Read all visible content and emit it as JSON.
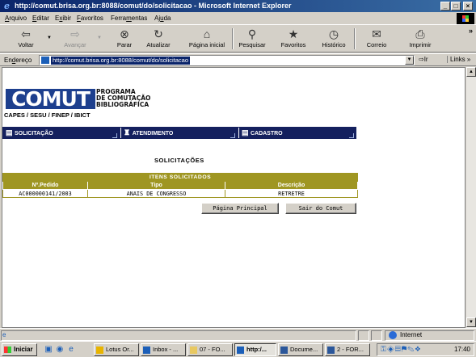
{
  "window": {
    "title": "http://comut.brisa.org.br:8088/comut/do/solicitacao - Microsoft Internet Explorer",
    "controls": {
      "minimize": "_",
      "maximize": "□",
      "close": "×"
    }
  },
  "menu": [
    {
      "label": "Arquivo",
      "key": "A",
      "rest": "rquivo"
    },
    {
      "label": "Editar",
      "key": "E",
      "rest": "ditar"
    },
    {
      "label": "Exibir",
      "pre": "E",
      "key": "x",
      "rest": "ibir"
    },
    {
      "label": "Favoritos",
      "key": "F",
      "rest": "avoritos"
    },
    {
      "label": "Ferramentas",
      "pre": "Ferra",
      "key": "m",
      "rest": "entas"
    },
    {
      "label": "Ajuda",
      "pre": "Aj",
      "key": "u",
      "rest": "da"
    }
  ],
  "toolbar": {
    "back": "Voltar",
    "forward": "Avançar",
    "stop": "Parar",
    "refresh": "Atualizar",
    "home": "Página inicial",
    "search": "Pesquisar",
    "favorites": "Favoritos",
    "history": "Histórico",
    "mail": "Correio",
    "print": "Imprimir",
    "more": "»"
  },
  "icons": {
    "back": "back-arrow-icon",
    "forward": "forward-arrow-icon",
    "stop": "stop-icon",
    "refresh": "refresh-icon",
    "home": "home-icon",
    "search": "search-icon",
    "favorites": "favorites-icon",
    "history": "history-icon",
    "mail": "mail-icon",
    "print": "printer-icon"
  },
  "address": {
    "label_pre": "En",
    "label_key": "d",
    "label_rest": "ereço",
    "url": "http://comut.brisa.org.br:8088/comut/do/solicitacao",
    "go": "Ir",
    "links": "Links »"
  },
  "page": {
    "logo_text": "COMUT",
    "logo_program_lines": [
      "PROGRAMA",
      "DE COMUTAÇÃO",
      "BIBLIOGRÁFICA"
    ],
    "sponsors": "CAPES / SESU / FINEP / IBICT",
    "nav": [
      "SOLICITAÇÃO",
      "ATENDIMENTO",
      "CADASTRO"
    ],
    "title": "SOLICITAÇÕES",
    "table": {
      "caption": "ITENS SOLICITADOS",
      "headers": [
        "Nº.Pedido",
        "Tipo",
        "Descrição"
      ],
      "rows": [
        [
          "AC000000141/2003",
          "ANAIS DE CONGRESSO",
          "RETRETRE"
        ]
      ]
    },
    "buttons": {
      "home": "Página Principal",
      "logout": "Sair do Comut"
    }
  },
  "status": {
    "zone": "Internet"
  },
  "taskbar": {
    "start": "Iniciar",
    "tasks": [
      {
        "label": "Lotus Or...",
        "color": "#e8b400"
      },
      {
        "label": "Inbox - ...",
        "color": "#1c5fb8"
      },
      {
        "label": "07 - FO...",
        "color": "#e8c860"
      },
      {
        "label": "http:/...",
        "color": "#1c5fb8",
        "active": true
      },
      {
        "label": "Docume...",
        "color": "#2b579a"
      },
      {
        "label": "2 - FOR...",
        "color": "#2b579a"
      }
    ],
    "clock": "17:40"
  }
}
